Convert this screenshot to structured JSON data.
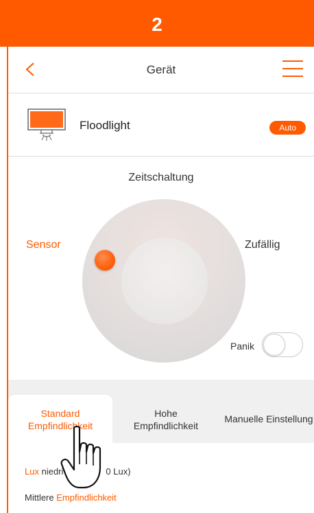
{
  "step": {
    "number": "2"
  },
  "nav": {
    "title": "Gerät"
  },
  "device": {
    "name": "Floodlight",
    "mode_badge": "Auto"
  },
  "dial": {
    "label_top": "Zeitschaltung",
    "label_left": "Sensor",
    "label_right": "Zufällig",
    "selected": "Sensor"
  },
  "panik": {
    "label": "Panik",
    "on": false
  },
  "tabs": [
    {
      "line1": "Standard",
      "line2": "Empfindlichkeit",
      "active": true
    },
    {
      "line1": "Hohe",
      "line2": "Empfindlichkeit",
      "active": false
    },
    {
      "line1": "Manuelle Einstellung",
      "line2": "",
      "active": false
    }
  ],
  "info": {
    "line1_accent": "Lux",
    "line1_rest_a": "niedri",
    "line1_rest_b": "0 Lux)",
    "line2_prefix": "Mittlere",
    "line2_accent": "Empfindlichkeit"
  },
  "colors": {
    "accent": "#ff5a00",
    "tab_bar": "#f0f0f0",
    "dial": "#e3dedd"
  },
  "icons": [
    "chevron-left-icon",
    "menu-icon",
    "floodlight-icon",
    "pointing-hand-icon"
  ]
}
